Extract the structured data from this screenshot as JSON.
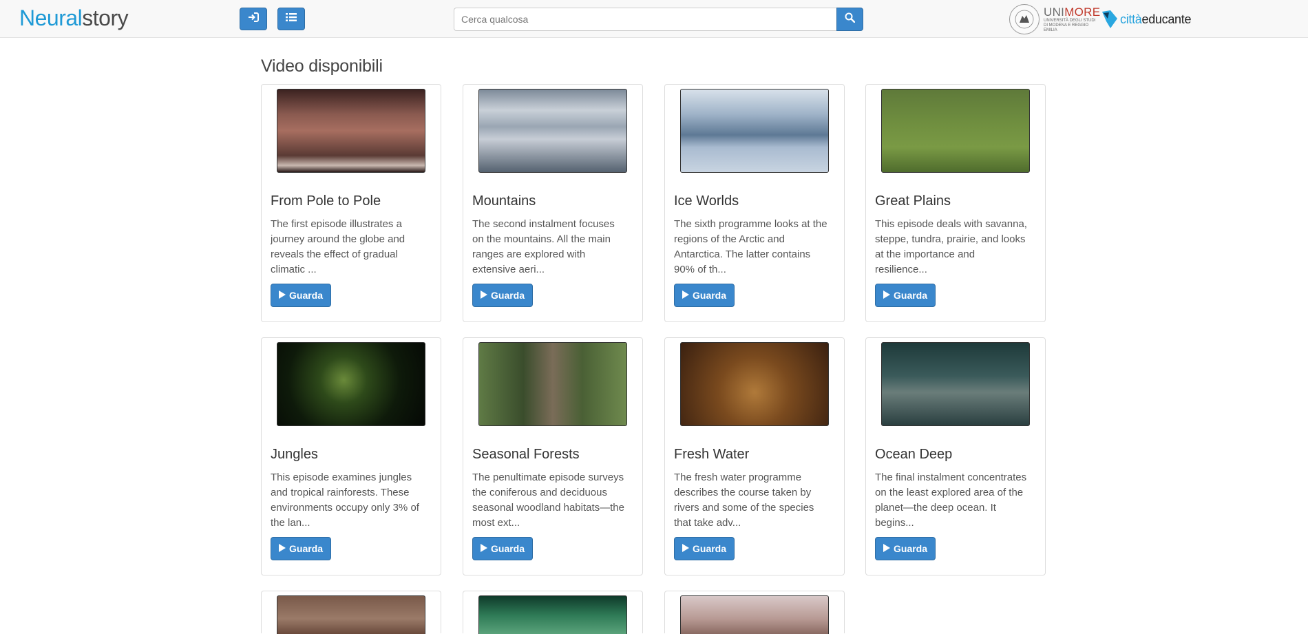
{
  "brand": {
    "part1": "Neural",
    "part2": "story"
  },
  "header": {
    "login_icon": "sign-in-icon",
    "menu_icon": "list-icon",
    "search_placeholder": "Cerca qualcosa",
    "search_icon": "search-icon"
  },
  "partners": {
    "unimore": {
      "name_a": "UNI",
      "name_b": "MORE",
      "sub": "UNIVERSITÀ DEGLI STUDI DI MODENA E REGGIO EMILIA"
    },
    "citta": {
      "name_a": "città",
      "name_b": "educante"
    }
  },
  "main": {
    "section_title": "Video disponibili",
    "watch_label": "Guarda",
    "videos": [
      {
        "title": "From Pole to Pole",
        "desc": "The first episode illustrates a journey around the globe and reveals the effect of gradual climatic ..."
      },
      {
        "title": "Mountains",
        "desc": "The second instalment focuses on the mountains. All the main ranges are explored with extensive aeri..."
      },
      {
        "title": "Ice Worlds",
        "desc": "The sixth programme looks at the regions of the Arctic and Antarctica. The latter contains 90% of th..."
      },
      {
        "title": "Great Plains",
        "desc": "This episode deals with savanna, steppe, tundra, prairie, and looks at the importance and resilience..."
      },
      {
        "title": "Jungles",
        "desc": "This episode examines jungles and tropical rainforests. These environments occupy only 3% of the lan..."
      },
      {
        "title": "Seasonal Forests",
        "desc": "The penultimate episode surveys the coniferous and deciduous seasonal woodland habitats—the most ext..."
      },
      {
        "title": "Fresh Water",
        "desc": "The fresh water programme describes the course taken by rivers and some of the species that take adv..."
      },
      {
        "title": "Ocean Deep",
        "desc": "The final instalment concentrates on the least explored area of the planet—the deep ocean. It begins..."
      }
    ]
  },
  "colors": {
    "primary": "#3a87cc",
    "brand_blue": "#1f9ad6",
    "navbar_bg": "#f8f8f8"
  }
}
